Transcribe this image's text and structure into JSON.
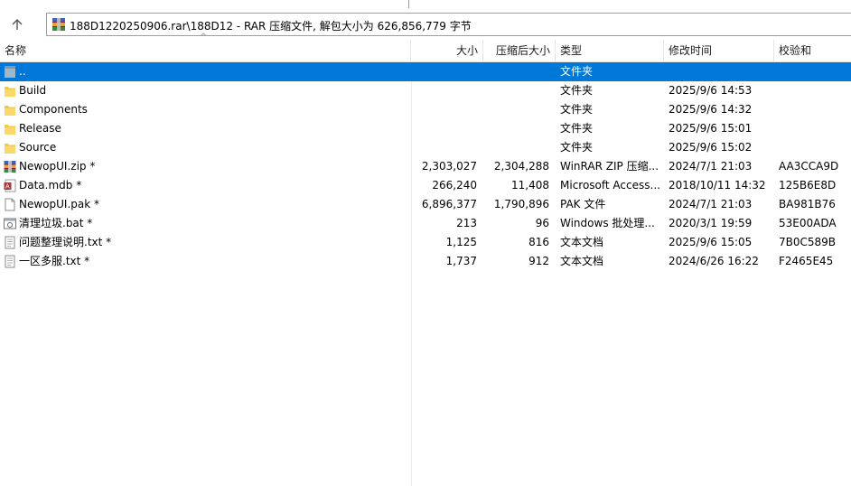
{
  "address": {
    "path_text": "188D1220250906.rar\\188D12 - RAR 压缩文件, 解包大小为 626,856,779 字节"
  },
  "columns": {
    "name": "名称",
    "size": "大小",
    "packed": "压缩后大小",
    "type": "类型",
    "modified": "修改时间",
    "crc": "校验和"
  },
  "files": [
    {
      "name": "..",
      "size": "",
      "packed": "",
      "type": "文件夹",
      "modified": "",
      "crc": "",
      "icon": "parent-folder-icon",
      "selected": true
    },
    {
      "name": "Build",
      "size": "",
      "packed": "",
      "type": "文件夹",
      "modified": "2025/9/6 14:53",
      "crc": "",
      "icon": "folder-icon"
    },
    {
      "name": "Components",
      "size": "",
      "packed": "",
      "type": "文件夹",
      "modified": "2025/9/6 14:32",
      "crc": "",
      "icon": "folder-icon"
    },
    {
      "name": "Release",
      "size": "",
      "packed": "",
      "type": "文件夹",
      "modified": "2025/9/6 15:01",
      "crc": "",
      "icon": "folder-icon"
    },
    {
      "name": "Source",
      "size": "",
      "packed": "",
      "type": "文件夹",
      "modified": "2025/9/6 15:02",
      "crc": "",
      "icon": "folder-icon"
    },
    {
      "name": "NewopUI.zip *",
      "size": "2,303,027",
      "packed": "2,304,288",
      "type": "WinRAR ZIP 压缩...",
      "modified": "2024/7/1 21:03",
      "crc": "AA3CCA9D",
      "icon": "zip-archive-icon"
    },
    {
      "name": "Data.mdb *",
      "size": "266,240",
      "packed": "11,408",
      "type": "Microsoft Access...",
      "modified": "2018/10/11 14:32",
      "crc": "125B6E8D",
      "icon": "access-db-icon"
    },
    {
      "name": "NewopUI.pak *",
      "size": "6,896,377",
      "packed": "1,790,896",
      "type": "PAK 文件",
      "modified": "2024/7/1 21:03",
      "crc": "BA981B76",
      "icon": "file-icon"
    },
    {
      "name": "清理垃圾.bat *",
      "size": "213",
      "packed": "96",
      "type": "Windows 批处理...",
      "modified": "2020/3/1 19:59",
      "crc": "53E00ADA",
      "icon": "batch-file-icon"
    },
    {
      "name": "问题整理说明.txt *",
      "size": "1,125",
      "packed": "816",
      "type": "文本文档",
      "modified": "2025/9/6 15:05",
      "crc": "7B0C589B",
      "icon": "text-file-icon"
    },
    {
      "name": "一区多服.txt *",
      "size": "1,737",
      "packed": "912",
      "type": "文本文档",
      "modified": "2024/6/26 16:22",
      "crc": "F2465E45",
      "icon": "text-file-icon"
    }
  ],
  "colors": {
    "selection": "#0078d7",
    "folder": "#f5c84c",
    "grid_line": "#e5e5e5"
  }
}
